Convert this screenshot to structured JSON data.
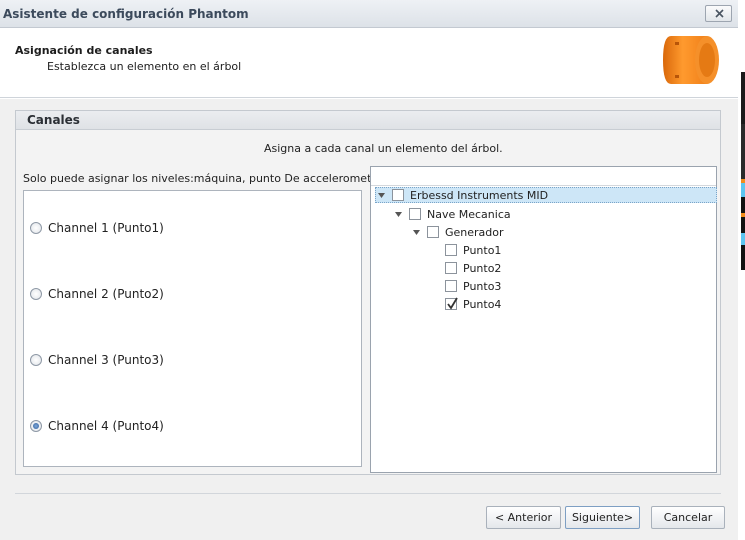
{
  "window": {
    "title": "Asistente de configuración Phantom"
  },
  "header": {
    "title": "Asignación de canales",
    "subtitle": "Establezca un elemento en el árbol"
  },
  "group": {
    "title": "Canales",
    "instruction": "Asigna a cada canal un elemento del árbol.",
    "note": "Solo puede asignar los niveles:máquina, punto De accelerometer"
  },
  "channels": [
    {
      "label": "Channel 1 (Punto1)",
      "selected": false
    },
    {
      "label": "Channel 2 (Punto2)",
      "selected": false
    },
    {
      "label": "Channel 3 (Punto3)",
      "selected": false
    },
    {
      "label": "Channel 4 (Punto4)",
      "selected": true
    }
  ],
  "tree": [
    {
      "label": "Erbessd Instruments MID",
      "level": 0,
      "expanded": true,
      "checked": false,
      "selected": true
    },
    {
      "label": "Nave Mecanica",
      "level": 1,
      "expanded": true,
      "checked": false,
      "selected": false
    },
    {
      "label": "Generador",
      "level": 2,
      "expanded": true,
      "checked": false,
      "selected": false
    },
    {
      "label": "Punto1",
      "level": 3,
      "checked": false,
      "selected": false
    },
    {
      "label": "Punto2",
      "level": 3,
      "checked": false,
      "selected": false
    },
    {
      "label": "Punto3",
      "level": 3,
      "checked": false,
      "selected": false
    },
    {
      "label": "Punto4",
      "level": 3,
      "checked": true,
      "selected": false
    }
  ],
  "buttons": {
    "back": "< Anterior",
    "next": "Siguiente>",
    "cancel": "Cancelar"
  },
  "colors": {
    "accent": "#4a90c8",
    "logo": "#f08a1c",
    "selection": "#cde6f7"
  }
}
